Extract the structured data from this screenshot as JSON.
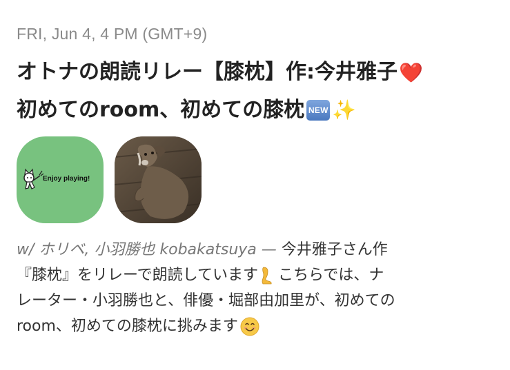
{
  "post": {
    "date": "FRI, Jun 4, 4 PM (GMT+9)",
    "title_line1": "オトナの朗読リレー【膝枕】作:今井雅子",
    "title_heart": "❤️",
    "title_line2": "初めてのroom、初めての膝枕",
    "title_new_badge": "NEW",
    "title_sparkles": "✨",
    "avatars": [
      {
        "caption": "Enjoy playing!",
        "color": "#78c27f"
      },
      {
        "color": "#4e4234"
      }
    ],
    "description": {
      "with_prefix": "w/ ホリベ, 小羽勝也 kobakatsuya —",
      "line1_text": " 今井雅子さん作",
      "line2": "『膝枕』をリレーで朗読しています",
      "line2_rest": " こちらでは、ナ",
      "line3": "レーター・小羽勝也と、俳優・堀部由加里が、初めての",
      "line4": "room、初めての膝枕に挑みます"
    }
  },
  "colors": {
    "date": "#8a8a8a",
    "title": "#222222",
    "heart": "#e0313b",
    "avatar_green": "#78c27f",
    "with_gray": "#777777"
  }
}
